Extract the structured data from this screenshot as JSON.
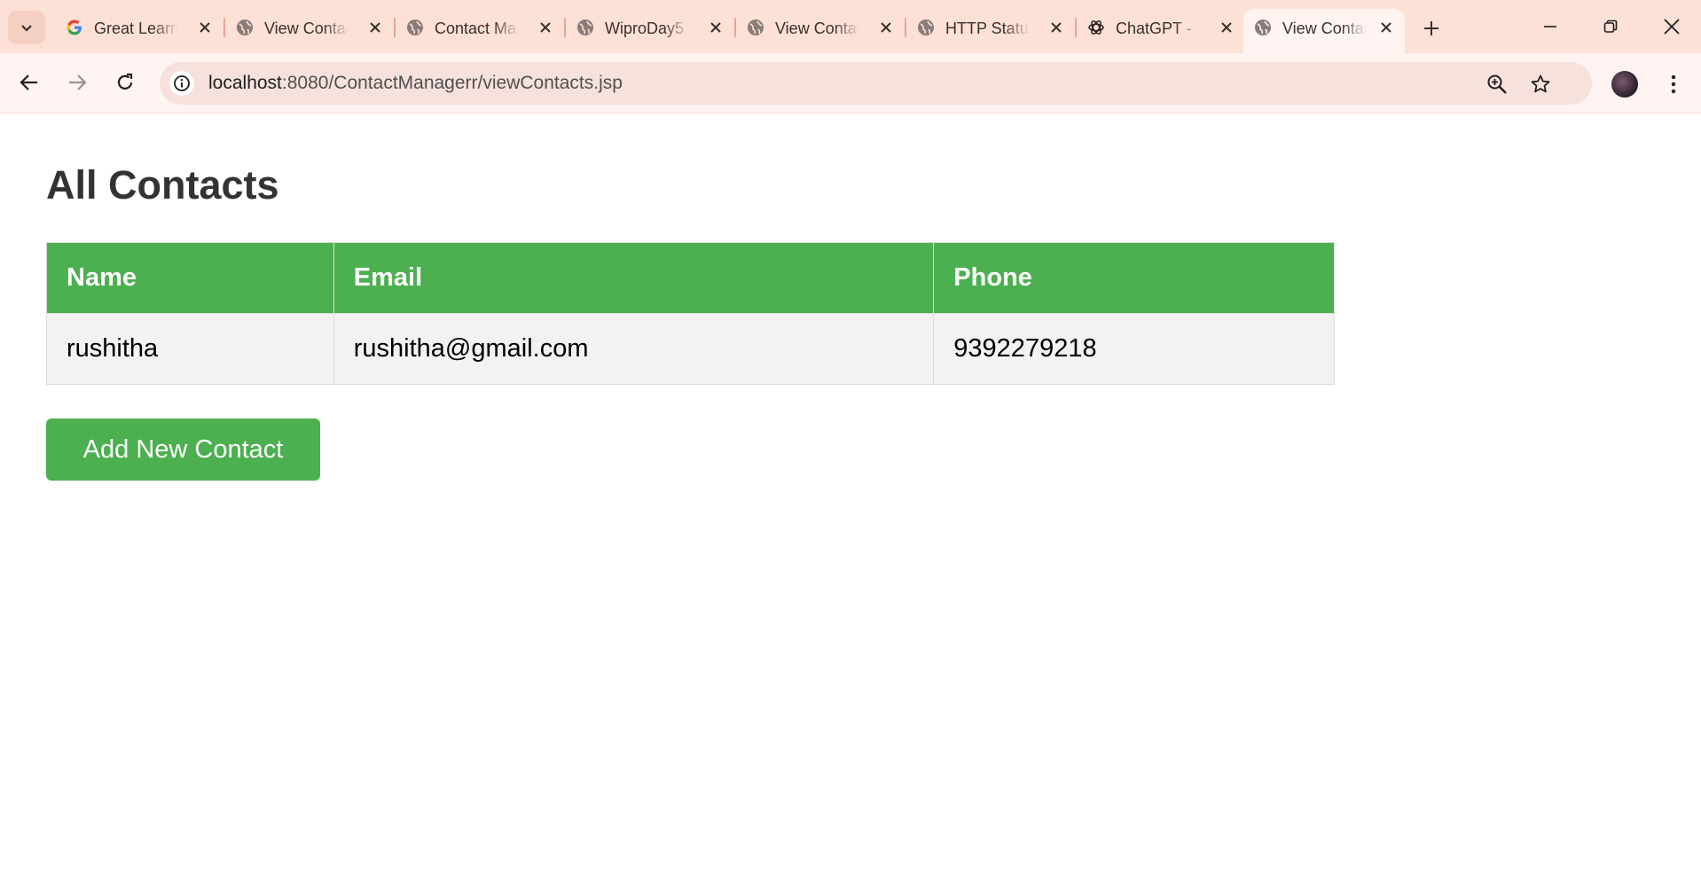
{
  "browser": {
    "tabs": [
      {
        "title": "Great Learning",
        "icon": "google-icon",
        "active": false
      },
      {
        "title": "View Contacts",
        "icon": "globe-icon",
        "active": false
      },
      {
        "title": "Contact Manager",
        "icon": "globe-icon",
        "active": false
      },
      {
        "title": "WiproDay5",
        "icon": "globe-icon",
        "active": false
      },
      {
        "title": "View Contacts",
        "icon": "globe-icon",
        "active": false
      },
      {
        "title": "HTTP Status",
        "icon": "globe-icon",
        "active": false
      },
      {
        "title": "ChatGPT - ",
        "icon": "chatgpt-icon",
        "active": false
      },
      {
        "title": "View Contacts",
        "icon": "globe-icon",
        "active": true
      }
    ],
    "url_host": "localhost",
    "url_rest": ":8080/ContactManagerr/viewContacts.jsp",
    "accent": "#fde0d6"
  },
  "page": {
    "heading": "All Contacts",
    "table": {
      "headers": [
        "Name",
        "Email",
        "Phone"
      ],
      "rows": [
        [
          "rushitha",
          "rushitha@gmail.com",
          "9392279218"
        ]
      ]
    },
    "add_button_label": "Add New Contact",
    "accent_color": "#4caf50"
  }
}
